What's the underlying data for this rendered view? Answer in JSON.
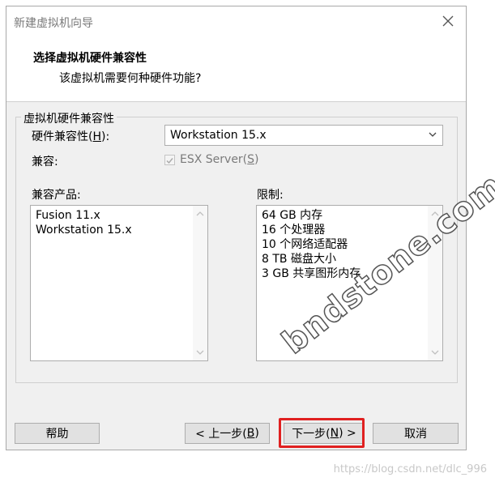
{
  "window": {
    "title": "新建虚拟机向导",
    "close_icon": "close-icon"
  },
  "header": {
    "title": "选择虚拟机硬件兼容性",
    "subtitle": "该虚拟机需要何种硬件功能?"
  },
  "group": {
    "title": "虚拟机硬件兼容性",
    "hardware_label_prefix": "硬件兼容性(",
    "hardware_label_key": "H",
    "hardware_label_suffix": "):",
    "hardware_value": "Workstation 15.x",
    "compat_label": "兼容:",
    "esx_label_prefix": "ESX Server(",
    "esx_label_key": "S",
    "esx_label_suffix": ")",
    "esx_checked": true,
    "products_label": "兼容产品:",
    "products": [
      "Fusion 11.x",
      "Workstation 15.x"
    ],
    "limits_label": "限制:",
    "limits": [
      "64 GB 内存",
      "16 个处理器",
      "10 个网络适配器",
      "8 TB 磁盘大小",
      "3 GB 共享图形内存"
    ]
  },
  "buttons": {
    "help": "帮助",
    "back_prefix": "< 上一步(",
    "back_key": "B",
    "back_suffix": ")",
    "next_prefix": "下一步(",
    "next_key": "N",
    "next_suffix": ") >",
    "cancel": "取消"
  },
  "overlay": {
    "watermark": "bndstone.com",
    "url": "https://blog.csdn.net/dlc_996",
    "highlight_color": "#e02020"
  }
}
